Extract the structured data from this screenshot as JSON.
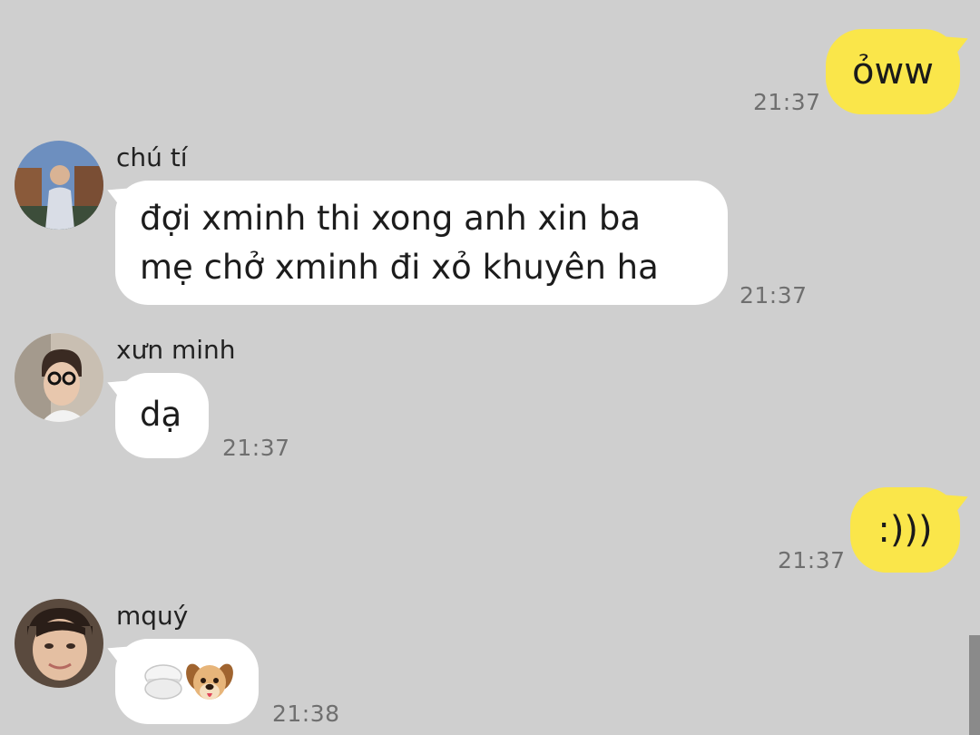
{
  "messages": [
    {
      "id": "m1",
      "direction": "outgoing",
      "text": "ỏww",
      "time": "21:37"
    },
    {
      "id": "m2",
      "direction": "incoming",
      "sender": "chú tí",
      "lines": [
        "đợi xminh thi xong anh xin ba",
        "mẹ chở xminh đi xỏ khuyên ha"
      ],
      "time": "21:37"
    },
    {
      "id": "m3",
      "direction": "incoming",
      "sender": "xưn minh",
      "text": "dạ",
      "time": "21:37"
    },
    {
      "id": "m4",
      "direction": "outgoing",
      "text": ":)))",
      "time": "21:37"
    },
    {
      "id": "m5",
      "direction": "incoming",
      "sender": "mquý",
      "stickers": [
        "macaron-emoji",
        "dog-face-emoji"
      ],
      "time": "21:38"
    }
  ],
  "colors": {
    "background": "#cfcfcf",
    "outgoing_bubble": "#fae64a",
    "incoming_bubble": "#ffffff",
    "timestamp": "#6f6f6f"
  }
}
